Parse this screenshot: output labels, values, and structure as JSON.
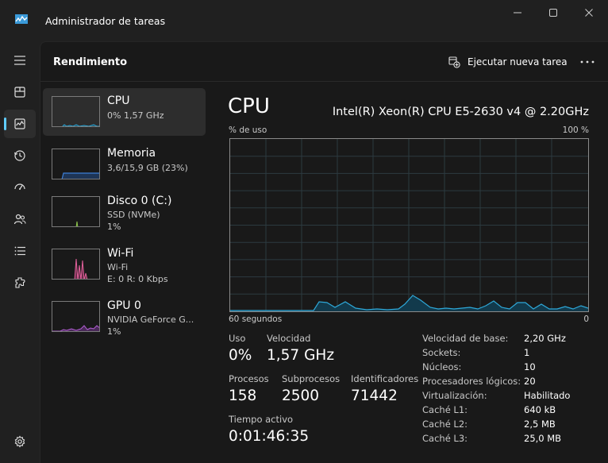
{
  "window": {
    "title": "Administrador de tareas"
  },
  "header": {
    "page_title": "Rendimiento",
    "run_task_label": "Ejecutar nueva tarea"
  },
  "nav": {
    "items": [
      {
        "icon": "hamburger-icon"
      },
      {
        "icon": "processes-icon"
      },
      {
        "icon": "performance-icon",
        "active": true
      },
      {
        "icon": "app-history-icon"
      },
      {
        "icon": "startup-icon"
      },
      {
        "icon": "users-icon"
      },
      {
        "icon": "details-icon"
      },
      {
        "icon": "services-icon"
      }
    ],
    "settings_icon": "gear-icon"
  },
  "devices": [
    {
      "name": "CPU",
      "sub1": "0%  1,57 GHz",
      "sub2": ""
    },
    {
      "name": "Memoria",
      "sub1": "3,6/15,9 GB (23%)",
      "sub2": ""
    },
    {
      "name": "Disco 0 (C:)",
      "sub1": "SSD (NVMe)",
      "sub2": "1%"
    },
    {
      "name": "Wi-Fi",
      "sub1": "Wi-Fi",
      "sub2": "E: 0 R: 0 Kbps"
    },
    {
      "name": "GPU 0",
      "sub1": "NVIDIA GeForce G...",
      "sub2": "1%"
    }
  ],
  "detail": {
    "title": "CPU",
    "model": "Intel(R) Xeon(R) CPU E5-2630 v4 @ 2.20GHz",
    "graph_top_left": "% de uso",
    "graph_top_right": "100 %",
    "graph_bottom_left": "60 segundos",
    "graph_bottom_right": "0",
    "stats": {
      "uso_label": "Uso",
      "uso_value": "0%",
      "velocidad_label": "Velocidad",
      "velocidad_value": "1,57 GHz",
      "procesos_label": "Procesos",
      "procesos_value": "158",
      "subprocesos_label": "Subprocesos",
      "subprocesos_value": "2500",
      "identificadores_label": "Identificadores",
      "identificadores_value": "71442",
      "tiempo_label": "Tiempo activo",
      "tiempo_value": "0:01:46:35"
    },
    "properties": [
      {
        "label": "Velocidad de base:",
        "value": "2,20 GHz"
      },
      {
        "label": "Sockets:",
        "value": "1"
      },
      {
        "label": "Núcleos:",
        "value": "10"
      },
      {
        "label": "Procesadores lógicos:",
        "value": "20"
      },
      {
        "label": "Virtualización:",
        "value": "Habilitado"
      },
      {
        "label": "Caché L1:",
        "value": "640 kB"
      },
      {
        "label": "Caché L2:",
        "value": "2,5 MB"
      },
      {
        "label": "Caché L3:",
        "value": "25,0 MB"
      }
    ]
  },
  "colors": {
    "cpu_line": "#2ea8d8",
    "memory_line": "#3d7fd6",
    "disk_line": "#8bc34a",
    "wifi_line": "#e0609a",
    "gpu_line": "#b45fd6",
    "accent": "#60cdff"
  }
}
